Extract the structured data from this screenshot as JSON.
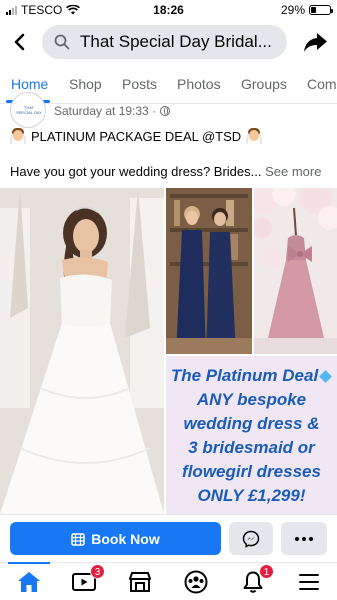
{
  "status_bar": {
    "carrier": "TESCO",
    "time": "18:26",
    "battery": "29%",
    "battery_level": 0.29
  },
  "header": {
    "search_query": "That Special Day Bridal..."
  },
  "tabs": [
    {
      "label": "Home",
      "active": true
    },
    {
      "label": "Shop"
    },
    {
      "label": "Posts"
    },
    {
      "label": "Photos"
    },
    {
      "label": "Groups"
    },
    {
      "label": "Comm"
    }
  ],
  "post": {
    "avatar_text": "THAT SPECIAL DAY",
    "time": "Saturday at 19:33 ·",
    "title": "PLATINUM PACKAGE DEAL @TSD",
    "body": "Have you got your wedding dress? Brides...",
    "see_more": "See more",
    "promo_lines": [
      "The Platinum Deal",
      "ANY bespoke",
      "wedding dress &",
      "3 bridesmaid or",
      "flowegirl dresses",
      "ONLY £1,299!"
    ]
  },
  "actions": {
    "book_label": "Book Now"
  },
  "bottom_nav": {
    "watch_badge": "3",
    "notifications_badge": "1"
  },
  "colors": {
    "accent": "#1877f2",
    "promo_text": "#1a5db8",
    "badge": "#e41e3f"
  }
}
